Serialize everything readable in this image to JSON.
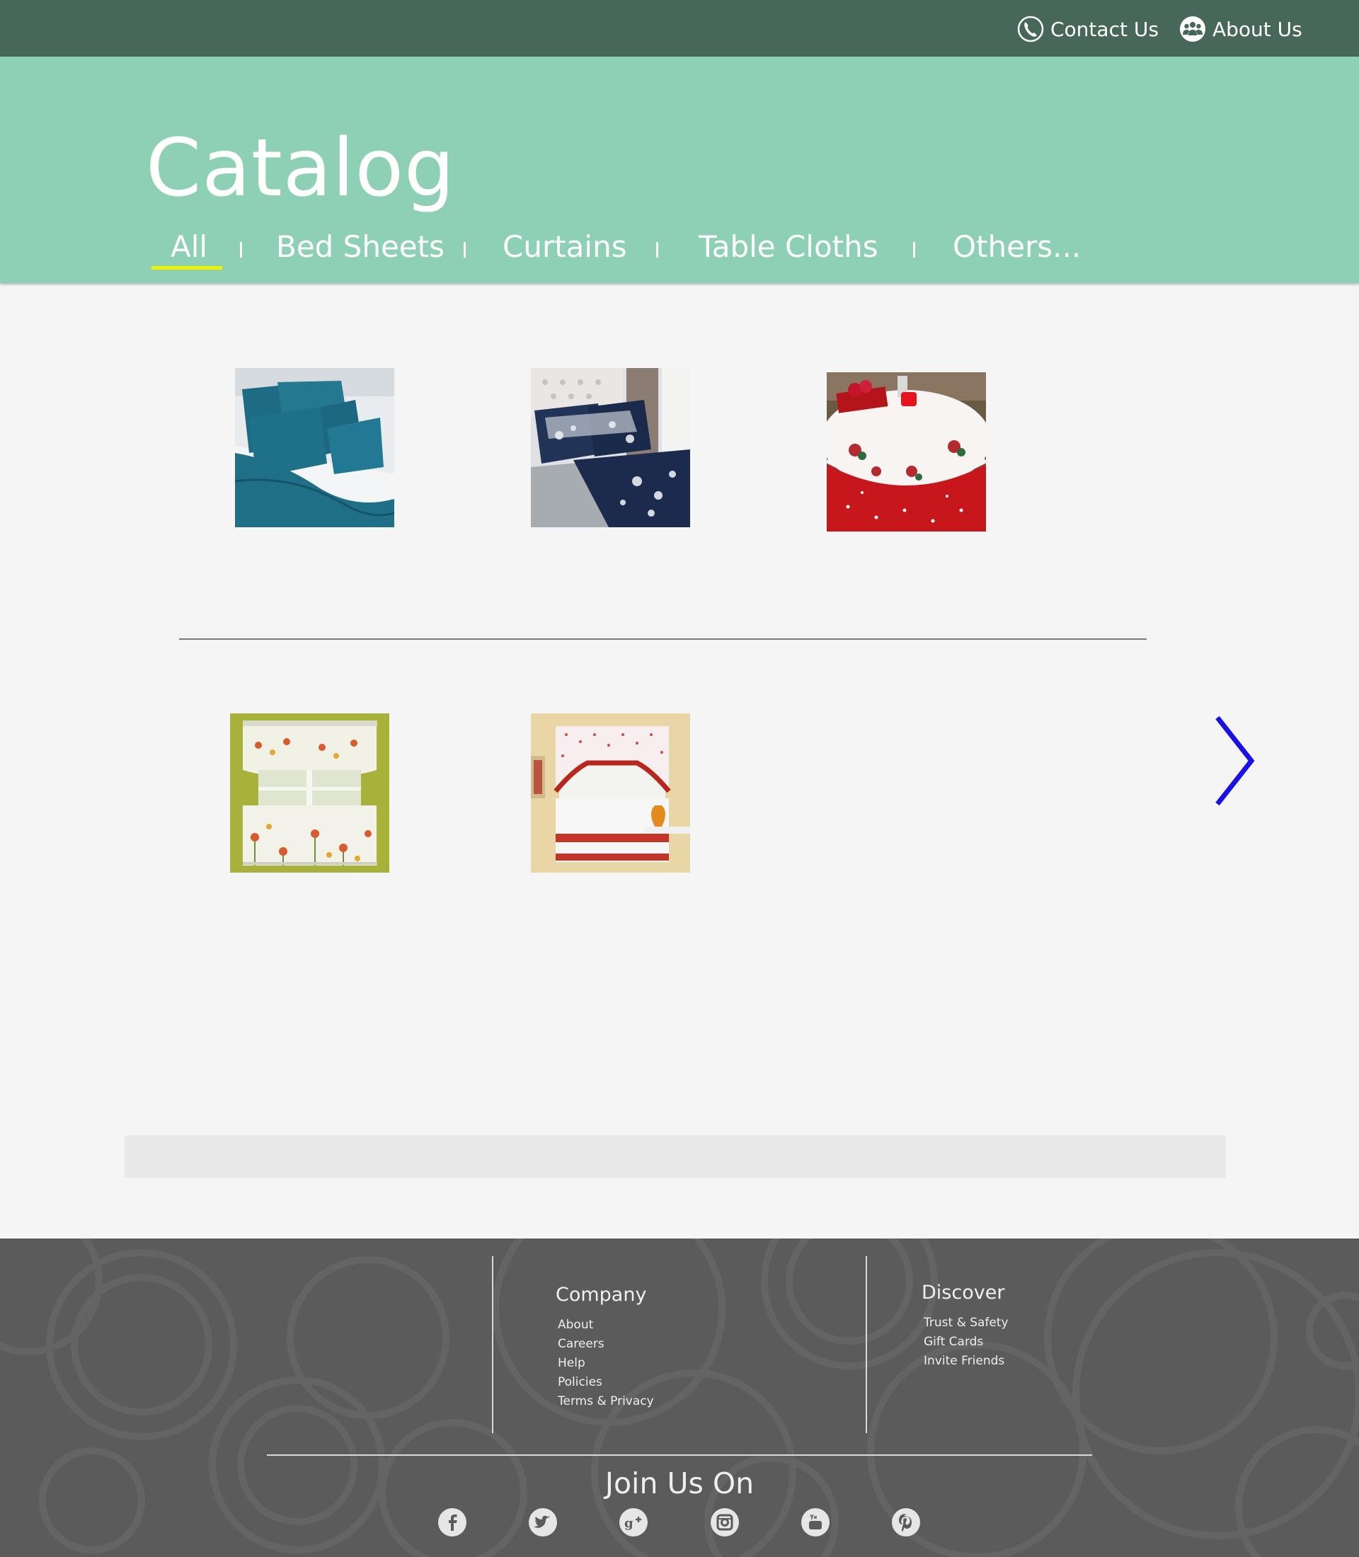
{
  "header": {
    "contact_label": "Contact Us",
    "about_label": "About Us"
  },
  "hero": {
    "title": "Catalog",
    "tabs": [
      {
        "label": "All",
        "active": true
      },
      {
        "label": "Bed Sheets",
        "active": false
      },
      {
        "label": "Curtains",
        "active": false
      },
      {
        "label": "Table Cloths",
        "active": false
      },
      {
        "label": "Others...",
        "active": false
      }
    ]
  },
  "catalog": {
    "items": [
      {
        "category": "Bed Sheets",
        "image": "teal-bedding-image"
      },
      {
        "category": "Bed Sheets",
        "image": "navy-floral-bedding-image"
      },
      {
        "category": "Table Cloths",
        "image": "red-christmas-tablecloth-image"
      },
      {
        "category": "Curtains",
        "image": "floral-kitchen-curtain-image"
      },
      {
        "category": "Curtains",
        "image": "red-trim-cafe-curtain-image"
      }
    ],
    "next_icon": "chevron-right-icon"
  },
  "footer": {
    "company_heading": "Company",
    "company_links": [
      "About",
      "Careers",
      "Help",
      "Policies",
      "Terms & Privacy"
    ],
    "discover_heading": "Discover",
    "discover_links": [
      "Trust & Safety",
      "Gift Cards",
      "Invite Friends"
    ],
    "join_label": "Join Us On",
    "social": [
      "facebook-icon",
      "twitter-icon",
      "google-plus-icon",
      "instagram-icon",
      "youtube-icon",
      "pinterest-icon"
    ]
  },
  "colors": {
    "topbar": "#466759",
    "hero": "#8ed0b6",
    "active_underline": "#f2f200",
    "arrow": "#1a10e8",
    "footer": "#5b5b5b"
  }
}
